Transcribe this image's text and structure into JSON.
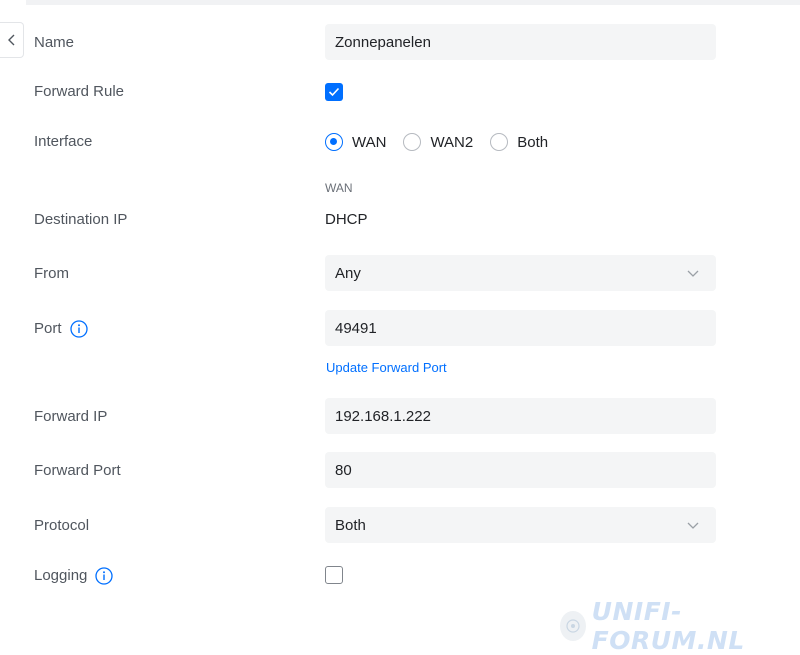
{
  "form": {
    "name": {
      "label": "Name",
      "value": "Zonnepanelen"
    },
    "forward_rule": {
      "label": "Forward Rule",
      "checked": true
    },
    "interface": {
      "label": "Interface",
      "options": [
        "WAN",
        "WAN2",
        "Both"
      ],
      "selected": "WAN"
    },
    "destination_ip": {
      "label": "Destination IP",
      "caption": "WAN",
      "value": "DHCP"
    },
    "from": {
      "label": "From",
      "value": "Any"
    },
    "port": {
      "label": "Port",
      "value": "49491",
      "link": "Update Forward Port"
    },
    "forward_ip": {
      "label": "Forward IP",
      "value": "192.168.1.222"
    },
    "forward_port": {
      "label": "Forward Port",
      "value": "80"
    },
    "protocol": {
      "label": "Protocol",
      "value": "Both"
    },
    "logging": {
      "label": "Logging",
      "checked": false
    }
  },
  "watermark": {
    "text": "UNIFI-FORUM.NL"
  },
  "colors": {
    "accent": "#006fff",
    "field_bg": "#f4f5f6",
    "label": "#50565e"
  },
  "icons": {
    "back": "chevron-left-icon",
    "info": "info-icon",
    "dropdown": "chevron-down-icon",
    "check": "checkmark-icon"
  }
}
